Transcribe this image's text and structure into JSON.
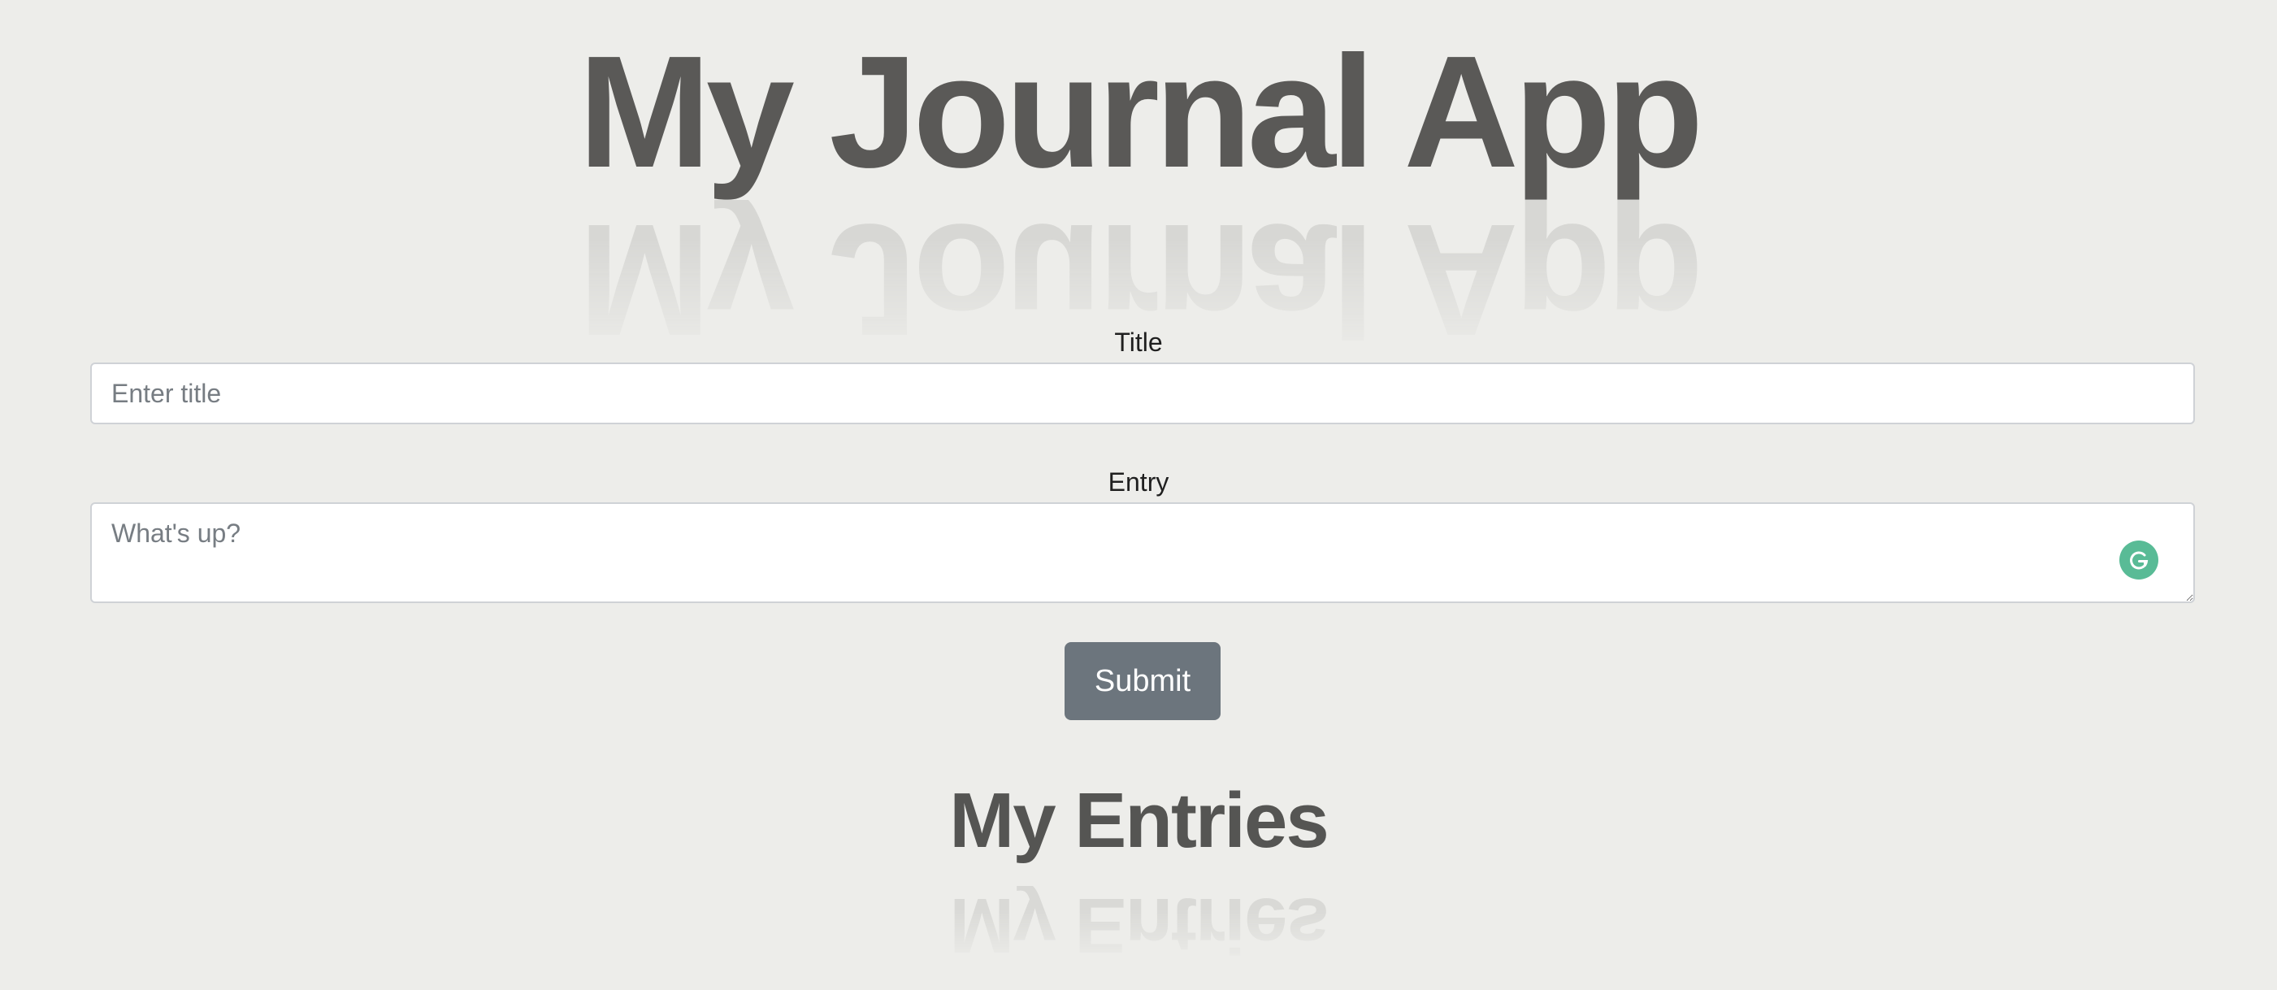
{
  "header": {
    "title": "My Journal App"
  },
  "form": {
    "title_label": "Title",
    "title_placeholder": "Enter title",
    "title_value": "",
    "entry_label": "Entry",
    "entry_placeholder": "What's up?",
    "entry_value": "",
    "submit_label": "Submit",
    "grammar_icon": "grammarly-icon"
  },
  "entries": {
    "heading": "My Entries"
  },
  "colors": {
    "background": "#ededea",
    "heading": "#5a5957",
    "button": "#6c757d",
    "grammar_badge": "#59bb96"
  }
}
